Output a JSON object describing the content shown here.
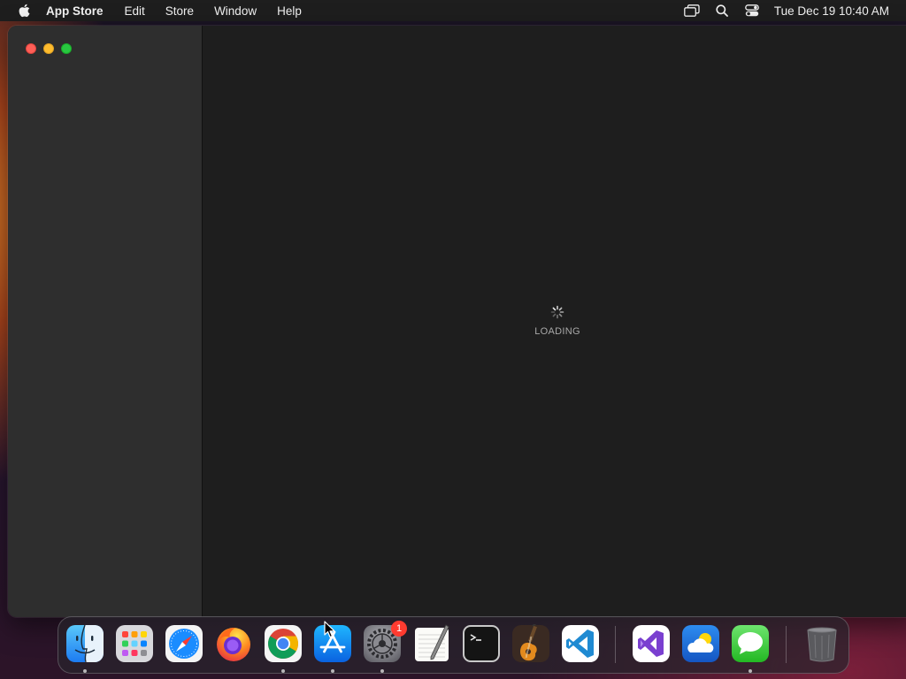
{
  "menubar": {
    "app_name": "App Store",
    "items": [
      "Edit",
      "Store",
      "Window",
      "Help"
    ],
    "clock": "Tue Dec 19  10:40 AM",
    "status_icons": [
      "screen-mirroring-icon",
      "spotlight-search-icon",
      "control-center-icon"
    ]
  },
  "window": {
    "traffic_lights": [
      "close",
      "minimize",
      "zoom"
    ],
    "loading_label": "LOADING"
  },
  "dock": {
    "apps": [
      {
        "name": "Finder",
        "icon": "finder-icon",
        "running": true
      },
      {
        "name": "Launchpad",
        "icon": "launchpad-icon",
        "running": false
      },
      {
        "name": "Safari",
        "icon": "safari-icon",
        "running": false
      },
      {
        "name": "Firefox",
        "icon": "firefox-icon",
        "running": false
      },
      {
        "name": "Google Chrome",
        "icon": "chrome-icon",
        "running": true
      },
      {
        "name": "App Store",
        "icon": "app-store-icon",
        "running": true
      },
      {
        "name": "System Settings",
        "icon": "system-settings-icon",
        "running": true,
        "badge": "1"
      },
      {
        "name": "TextEdit",
        "icon": "textedit-icon",
        "running": false
      },
      {
        "name": "Terminal",
        "icon": "terminal-icon",
        "running": false
      },
      {
        "name": "GarageBand",
        "icon": "garageband-icon",
        "running": false
      },
      {
        "name": "Visual Studio Code",
        "icon": "vscode-icon",
        "running": false
      },
      {
        "name": "Visual Studio",
        "icon": "visual-studio-icon",
        "running": false
      },
      {
        "name": "Weather",
        "icon": "weather-icon",
        "running": false
      },
      {
        "name": "Messages",
        "icon": "messages-icon",
        "running": true
      },
      {
        "name": "Trash",
        "icon": "trash-icon",
        "running": false
      }
    ]
  },
  "colors": {
    "menubar_bg": "#1e1e1e",
    "sidebar_bg": "#2e2e2e",
    "content_bg": "#1e1e1e",
    "close": "#ff5f57",
    "minimize": "#febc2e",
    "zoom": "#28c840",
    "badge": "#ff3b30"
  }
}
